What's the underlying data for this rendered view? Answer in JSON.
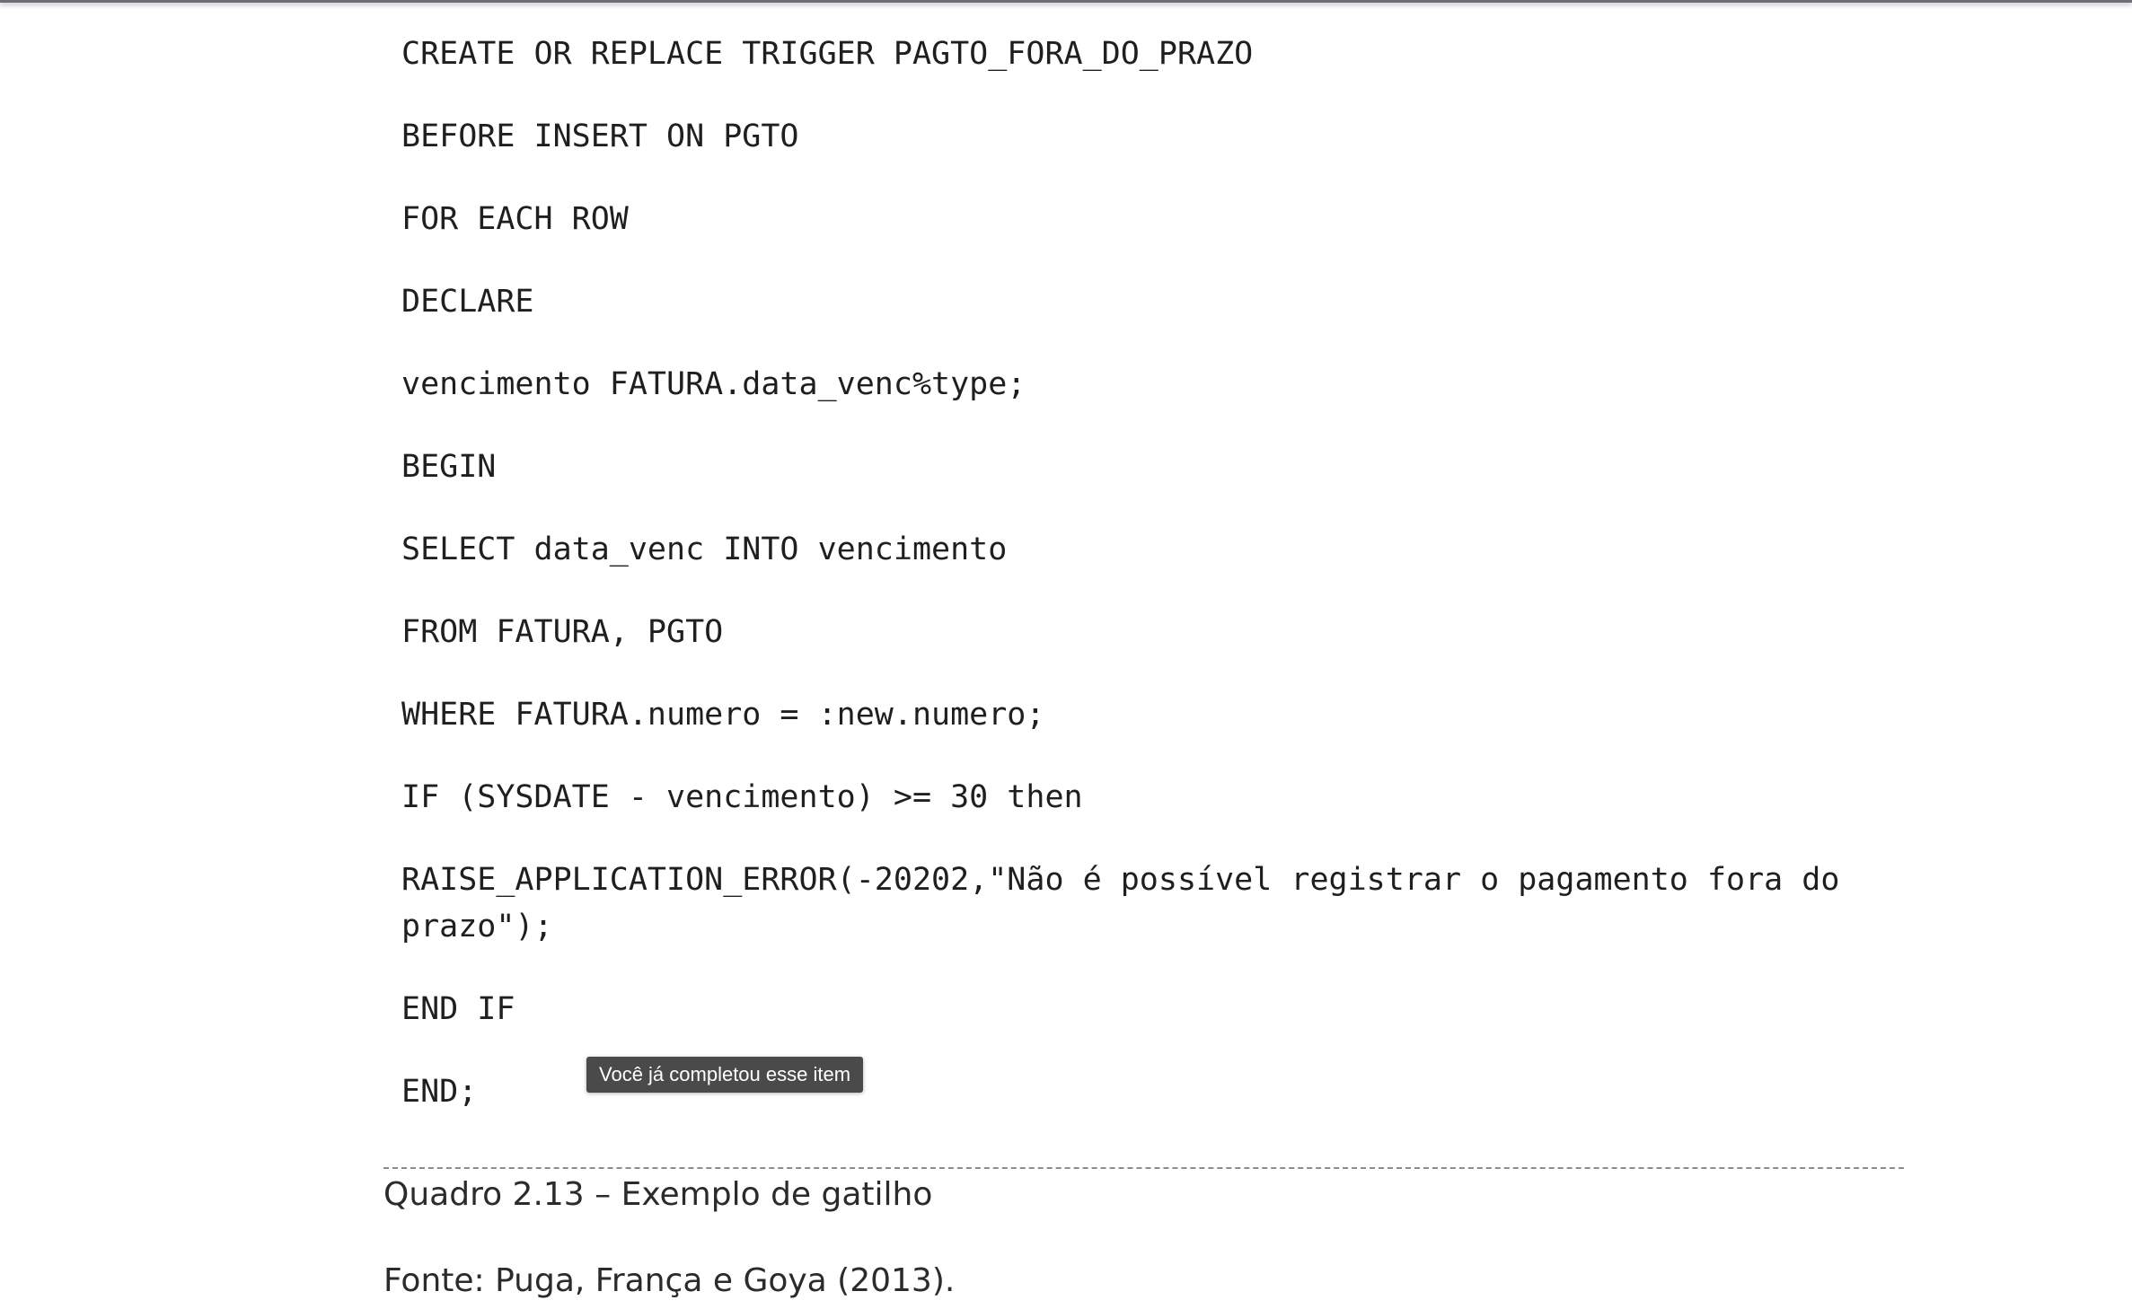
{
  "code_lines": [
    "CREATE OR REPLACE TRIGGER PAGTO_FORA_DO_PRAZO",
    "BEFORE INSERT ON PGTO",
    "FOR EACH ROW",
    "DECLARE",
    "vencimento FATURA.data_venc%type;",
    "BEGIN",
    "SELECT data_venc INTO vencimento",
    "FROM FATURA, PGTO",
    "WHERE FATURA.numero = :new.numero;",
    "IF (SYSDATE - vencimento) >= 30 then",
    "RAISE_APPLICATION_ERROR(-20202,\"Não é possível registrar o pagamento fora do prazo\");",
    "END IF",
    "END;"
  ],
  "tooltip": {
    "text": "Você já completou esse item"
  },
  "caption": {
    "title": "Quadro 2.13 – Exemplo de gatilho",
    "source": "Fonte: Puga, França e Goya (2013)."
  }
}
